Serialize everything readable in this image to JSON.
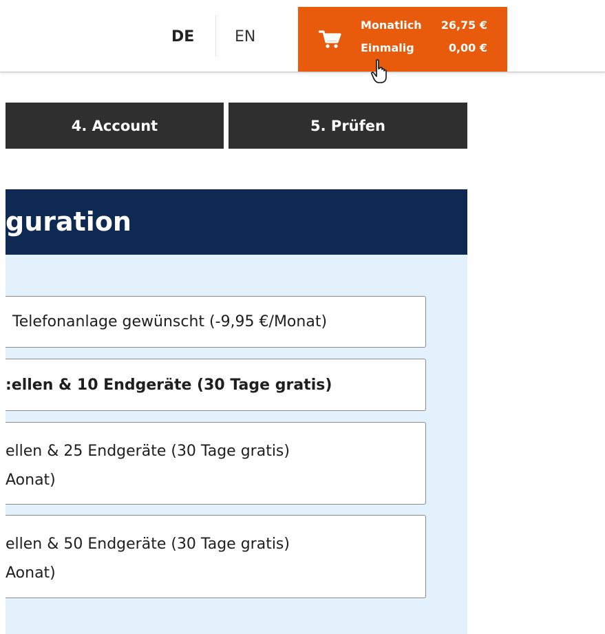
{
  "header": {
    "languages": [
      {
        "code": "DE",
        "active": true
      },
      {
        "code": "EN",
        "active": false
      }
    ],
    "cart": {
      "icon": "shopping-cart-icon",
      "monthly_label": "Monatlich",
      "monthly_value": "26,75 €",
      "once_label": "Einmalig",
      "once_value": "0,00 €",
      "background": "#e85a0c"
    }
  },
  "steps": [
    {
      "label": "4. Account"
    },
    {
      "label": "5. Prüfen"
    }
  ],
  "panel": {
    "title": "guration",
    "header_color": "#0e2a52",
    "background": "#e3f1fc",
    "options": [
      {
        "lines": [
          "Telefonanlage gewünscht (-9,95 €/Monat)"
        ],
        "selected": false
      },
      {
        "lines": [
          ":ellen & 10 Endgeräte (30 Tage gratis)"
        ],
        "selected": true
      },
      {
        "lines": [
          "ellen & 25 Endgeräte (30 Tage gratis)",
          "Aonat)"
        ],
        "selected": false
      },
      {
        "lines": [
          "ellen & 50 Endgeräte (30 Tage gratis)",
          "Aonat)"
        ],
        "selected": false
      }
    ]
  }
}
